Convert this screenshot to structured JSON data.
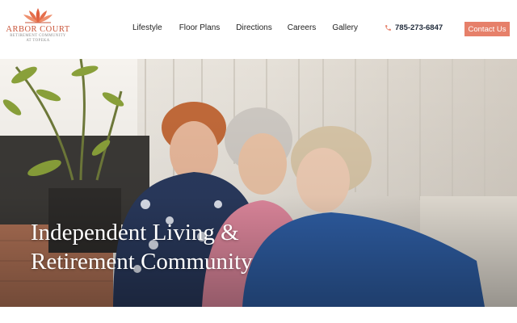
{
  "brand": {
    "name": "ARBOR COURT",
    "tagline_line1": "RETIREMENT COMMUNITY",
    "tagline_line2": "AT TOPEKA",
    "color": "#c9553a"
  },
  "nav": {
    "items": [
      {
        "label": "Lifestyle"
      },
      {
        "label": "Floor Plans"
      },
      {
        "label": "Directions"
      },
      {
        "label": "Careers"
      },
      {
        "label": "Gallery"
      }
    ]
  },
  "header": {
    "phone": "785-273-6847",
    "phone_icon": "phone-icon",
    "contact_label": "Contact Us",
    "accent": "#e6806a"
  },
  "hero": {
    "title_line1": "Independent Living &",
    "title_line2": "Retirement Community"
  }
}
